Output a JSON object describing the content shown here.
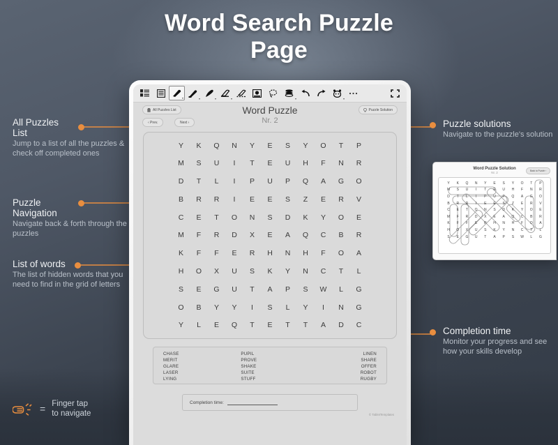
{
  "page": {
    "title_line1": "Word Search Puzzle",
    "title_line2": "Page"
  },
  "tablet": {
    "toolbar": [
      {
        "icon": "panel-layout-icon",
        "label": "Panel layout"
      },
      {
        "icon": "text-lines-icon",
        "label": "Text lines"
      },
      {
        "icon": "pen-icon",
        "label": "Pen"
      },
      {
        "icon": "marker-icon",
        "label": "Marker"
      },
      {
        "icon": "brush-icon",
        "label": "Brush"
      },
      {
        "icon": "eraser-icon",
        "label": "Eraser"
      },
      {
        "icon": "erase-selection-icon",
        "label": "Erase selection"
      },
      {
        "icon": "image-icon",
        "label": "Insert image"
      },
      {
        "icon": "lasso-icon",
        "label": "Lasso select"
      },
      {
        "icon": "layers-icon",
        "label": "Layers"
      },
      {
        "icon": "undo-icon",
        "label": "Undo"
      },
      {
        "icon": "redo-icon",
        "label": "Redo"
      },
      {
        "icon": "sticker-icon",
        "label": "Sticker"
      },
      {
        "icon": "more-icon",
        "label": "More"
      },
      {
        "icon": "fullscreen-icon",
        "label": "Full screen"
      }
    ],
    "buttons": {
      "all_puzzles_list": "All Puzzles List",
      "prev": "‹ Prev.",
      "next": "Next ›",
      "puzzle_solution": "Puzzle Solution"
    },
    "puzzle": {
      "title": "Word Puzzle",
      "number": "Nr. 2",
      "grid": [
        [
          "Y",
          "K",
          "Q",
          "N",
          "Y",
          "E",
          "S",
          "Y",
          "O",
          "T",
          "P"
        ],
        [
          "M",
          "S",
          "U",
          "I",
          "T",
          "E",
          "U",
          "H",
          "F",
          "N",
          "R"
        ],
        [
          "D",
          "T",
          "L",
          "I",
          "P",
          "U",
          "P",
          "Q",
          "A",
          "G",
          "O"
        ],
        [
          "B",
          "R",
          "R",
          "I",
          "E",
          "E",
          "S",
          "Z",
          "E",
          "R",
          "V"
        ],
        [
          "C",
          "E",
          "T",
          "O",
          "N",
          "S",
          "D",
          "K",
          "Y",
          "O",
          "E"
        ],
        [
          "M",
          "F",
          "R",
          "D",
          "X",
          "E",
          "A",
          "Q",
          "C",
          "B",
          "R"
        ],
        [
          "K",
          "F",
          "F",
          "E",
          "R",
          "H",
          "N",
          "H",
          "F",
          "O",
          "A"
        ],
        [
          "H",
          "O",
          "X",
          "U",
          "S",
          "K",
          "Y",
          "N",
          "C",
          "T",
          "L"
        ],
        [
          "S",
          "E",
          "G",
          "U",
          "T",
          "A",
          "P",
          "S",
          "W",
          "L",
          "G"
        ],
        [
          "O",
          "B",
          "Y",
          "Y",
          "I",
          "S",
          "L",
          "Y",
          "I",
          "N",
          "G"
        ],
        [
          "Y",
          "L",
          "E",
          "Q",
          "T",
          "E",
          "T",
          "T",
          "A",
          "D",
          "C"
        ]
      ],
      "words": {
        "column1": [
          "CHASE",
          "MERIT",
          "GLARE",
          "LASER",
          "LYING"
        ],
        "column2": [
          "PUPIL",
          "PROVE",
          "SHAKE",
          "SUITE",
          "STUFF"
        ],
        "column3": [
          "LINEN",
          "SHARE",
          "OFFER",
          "ROBOT",
          "RUGBY"
        ]
      },
      "completion_label": "Completion time:",
      "completion_value": "",
      "copyright": "© TabletTemplates"
    }
  },
  "solution_preview": {
    "title": "Word Puzzle Solution",
    "number": "Nr. 2",
    "back_button": "Back to Puzzle ›",
    "grid": [
      [
        "Y",
        "K",
        "Q",
        "N",
        "Y",
        "E",
        "S",
        "Y",
        "O",
        "T",
        "P"
      ],
      [
        "M",
        "S",
        "U",
        "I",
        "T",
        "E",
        "U",
        "H",
        "F",
        "N",
        "R"
      ],
      [
        "D",
        "T",
        "L",
        "I",
        "P",
        "U",
        "P",
        "Q",
        "A",
        "G",
        "O"
      ],
      [
        "B",
        "R",
        "R",
        "I",
        "E",
        "E",
        "S",
        "Z",
        "E",
        "R",
        "V"
      ],
      [
        "C",
        "E",
        "T",
        "O",
        "N",
        "S",
        "D",
        "K",
        "Y",
        "O",
        "E"
      ],
      [
        "M",
        "F",
        "R",
        "D",
        "X",
        "E",
        "A",
        "Q",
        "C",
        "B",
        "R"
      ],
      [
        "K",
        "F",
        "F",
        "E",
        "R",
        "H",
        "N",
        "H",
        "F",
        "O",
        "A"
      ],
      [
        "H",
        "O",
        "X",
        "U",
        "S",
        "K",
        "Y",
        "N",
        "C",
        "T",
        "L"
      ],
      [
        "S",
        "E",
        "G",
        "U",
        "T",
        "A",
        "P",
        "S",
        "W",
        "L",
        "G"
      ]
    ]
  },
  "annotations": {
    "all_puzzles": {
      "title": "All Puzzles\nList",
      "title_line1": "All Puzzles",
      "title_line2": "List",
      "body": "Jump to a list of all the puzzles & check off completed ones"
    },
    "puzzle_navigation": {
      "title_line1": "Puzzle",
      "title_line2": "Navigation",
      "body": "Navigate back & forth through the puzzles"
    },
    "list_of_words": {
      "title_line1": "List of words",
      "body": "The list of hidden words that you need to find in the grid of letters"
    },
    "puzzle_solutions": {
      "title_line1": "Puzzle solutions",
      "body": "Navigate to the puzzle's solution"
    },
    "completion_time": {
      "title_line1": "Completion time",
      "body": "Monitor your progress and see how your skills develop"
    }
  },
  "legend": {
    "icon": "finger-tap-icon",
    "equals": "=",
    "line1": "Finger tap",
    "line2": "to navigate"
  },
  "colors": {
    "accent": "#e98e3f",
    "bg_dark": "#3c4450",
    "text_light": "#f0f2f4"
  }
}
